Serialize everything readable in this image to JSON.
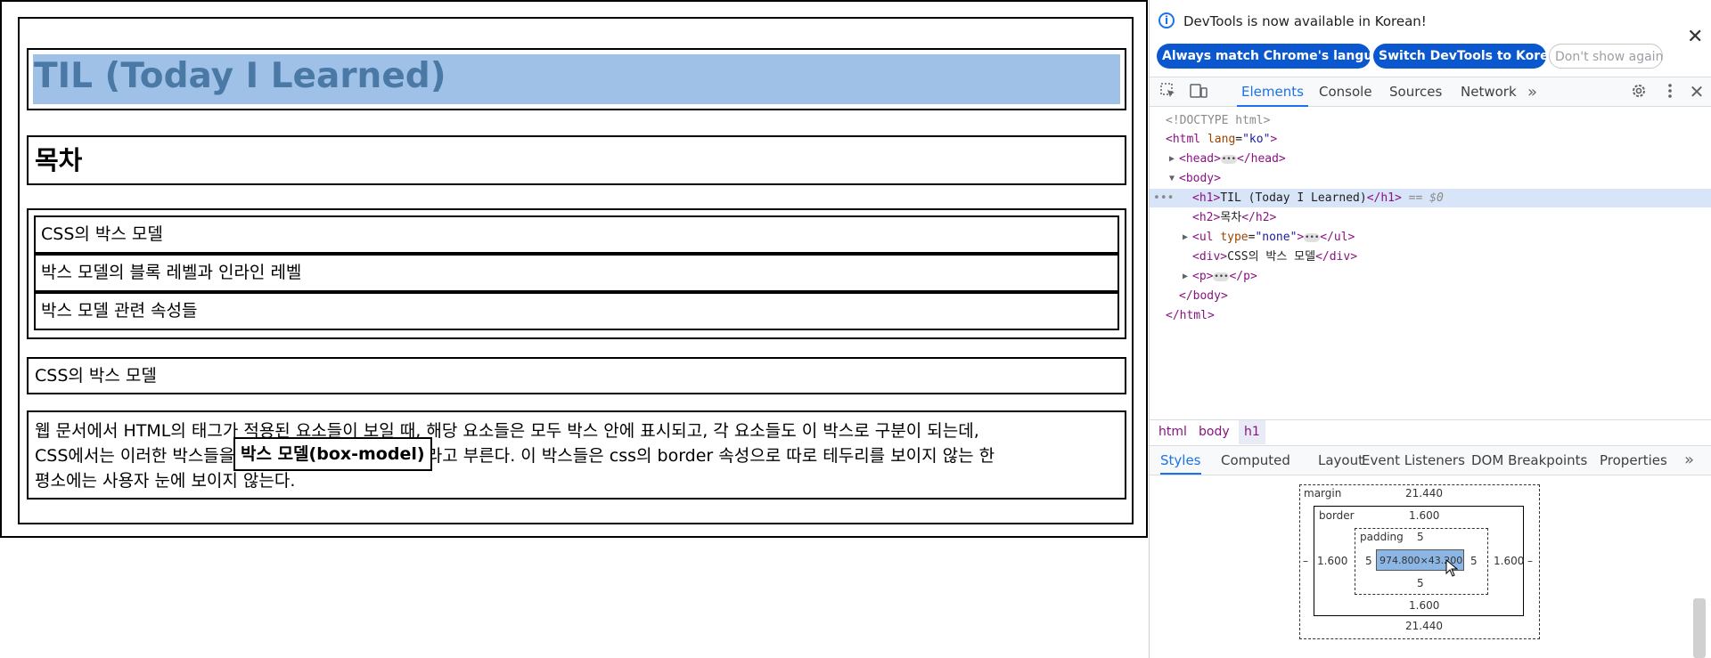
{
  "page": {
    "h1": "TIL (Today I Learned)",
    "h2": "목차",
    "list_items": [
      "CSS의 박스 모델",
      "박스 모델의 블록 레벨과 인라인 레벨",
      "박스 모델 관련 속성들"
    ],
    "div_text": "CSS의 박스 모델",
    "paragraph": {
      "line1": "웹 문서에서 HTML의 태그가 적용된 요소들이 보일 때, 해당 요소들은 모두 박스 안에 표시되고, 각 요소들도 이 박스로 구분이 되는데,",
      "line2_before": "CSS에서는 이러한 박스들을",
      "term": "박스 모델(box-model)",
      "line2_after": "이라고 부른다. 이 박스들은 css의 border 속성으로 따로 테두리를 보이지 않는 한",
      "line3": "평소에는 사용자 눈에 보이지 않는다."
    }
  },
  "devtools": {
    "infobar": {
      "message": "DevTools is now available in Korean!",
      "btn_match": "Always match Chrome's language",
      "btn_switch": "Switch DevTools to Korean",
      "btn_dont": "Don't show again",
      "close": "✕"
    },
    "tabs": {
      "elements": "Elements",
      "console": "Console",
      "sources": "Sources",
      "network": "Network",
      "more": "»"
    },
    "dom": {
      "doctype": "<!DOCTYPE html>",
      "html_open_tag": "<html",
      "html_attr": "lang",
      "html_val": "\"ko\"",
      "head_open": "<head>",
      "head_close": "</head>",
      "body_open": "<body>",
      "h1_open": "<h1>",
      "h1_text": "TIL (Today I Learned)",
      "h1_close": "</h1>",
      "h1_eq": "== $0",
      "h2_open": "<h2>",
      "h2_text": "목차",
      "h2_close": "</h2>",
      "ul_open": "<ul",
      "ul_attr": "type",
      "ul_val": "\"none\"",
      "ul_close": "</ul>",
      "div_open": "<div>",
      "div_text": "CSS의 박스 모델",
      "div_close": "</div>",
      "p_open": "<p>",
      "p_close": "</p>",
      "body_close": "</body>",
      "html_close": "</html>"
    },
    "breadcrumbs": [
      "html",
      "body",
      "h1"
    ],
    "subtabs": {
      "styles": "Styles",
      "computed": "Computed",
      "layout": "Layout",
      "events": "Event Listeners",
      "dom_bp": "DOM Breakpoints",
      "props": "Properties",
      "more": "»"
    },
    "box_model": {
      "margin_label": "margin",
      "margin_top": "21.440",
      "margin_bottom": "21.440",
      "margin_left": "–",
      "margin_right": "–",
      "border_label": "border",
      "border_top": "1.600",
      "border_bottom": "1.600",
      "border_left": "1.600",
      "border_right": "1.600",
      "padding_label": "padding",
      "padding_top": "5",
      "padding_bottom": "5",
      "padding_left": "5",
      "padding_right": "5",
      "content": "974.800×43.200"
    }
  }
}
